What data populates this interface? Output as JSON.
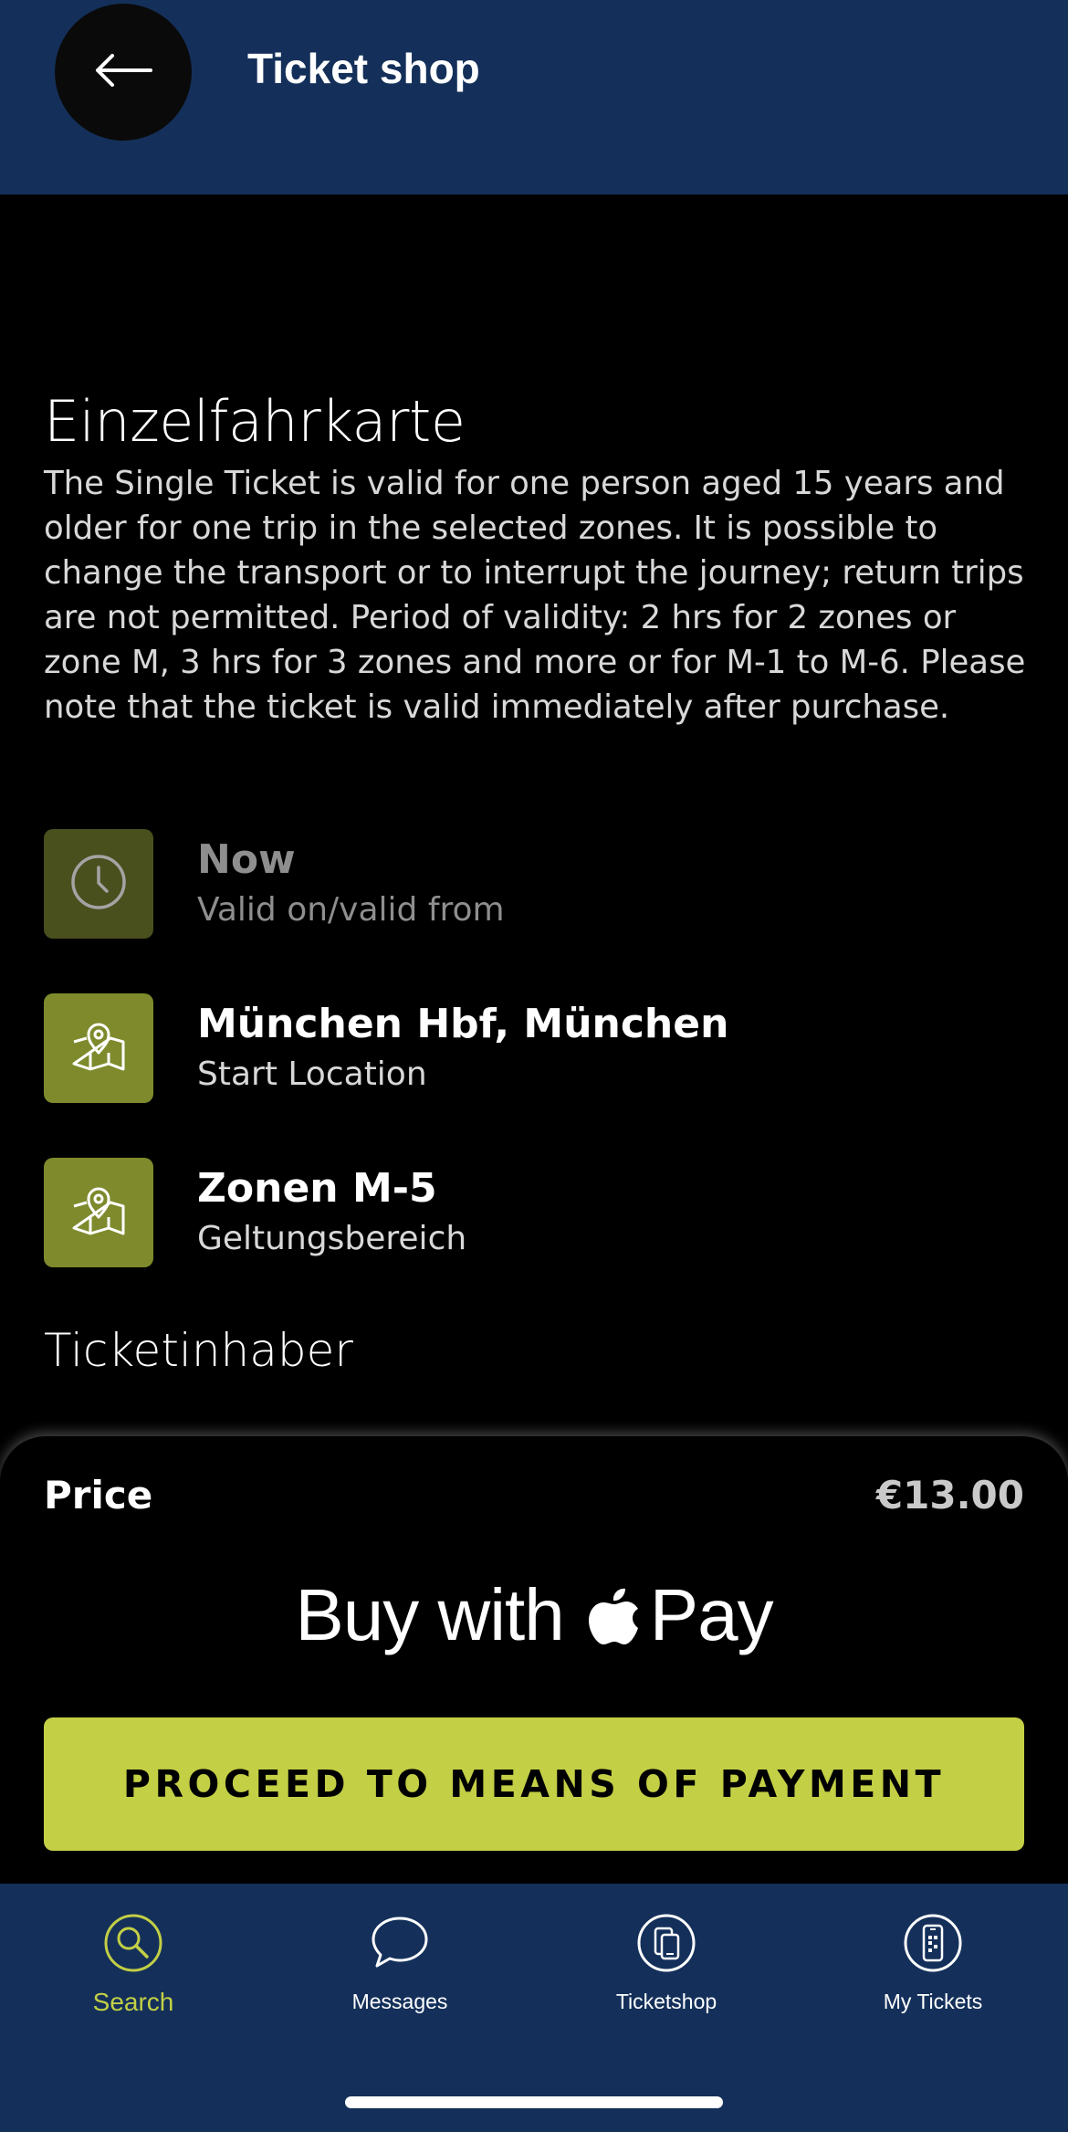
{
  "header": {
    "title": "Ticket shop",
    "back_icon": "arrow-left-icon"
  },
  "ticket": {
    "name": "Einzelfahrkarte",
    "description": "The Single Ticket is valid for one person aged 15 years and older for one trip in the selected zones. It is possible to change the transport or to interrupt the journey; return trips are not permitted. Period of validity: 2 hrs for 2 zones or zone M, 3 hrs for 3 zones and more or for M-1 to M-6. Please note that the ticket is valid immediately after purchase."
  },
  "details": [
    {
      "icon": "clock-icon",
      "title": "Now",
      "subtitle": "Valid on/valid from"
    },
    {
      "icon": "map-icon",
      "title": "München Hbf, München",
      "subtitle": "Start Location"
    },
    {
      "icon": "map-icon",
      "title": "Zonen M-5",
      "subtitle": "Geltungsbereich"
    }
  ],
  "holder_section": {
    "title": "Ticketinhaber"
  },
  "checkout": {
    "price_label": "Price",
    "price_value": "€13.00",
    "apple_pay": {
      "prefix": "Buy with",
      "suffix": "Pay",
      "icon": "apple-logo-icon"
    },
    "proceed_label": "PROCEED TO MEANS OF PAYMENT"
  },
  "tabbar": {
    "tabs": [
      {
        "label": "Search",
        "icon": "search-icon",
        "active": true
      },
      {
        "label": "Messages",
        "icon": "message-bubble-icon",
        "active": false
      },
      {
        "label": "Ticketshop",
        "icon": "ticketshop-icon",
        "active": false
      },
      {
        "label": "My Tickets",
        "icon": "phone-ticket-icon",
        "active": false
      }
    ]
  },
  "colors": {
    "header_bg": "#14305a",
    "accent": "#c3cf45",
    "icon_tile": "#7e8a2c",
    "icon_tile_dim": "#4a4f1e",
    "background": "#000000"
  }
}
